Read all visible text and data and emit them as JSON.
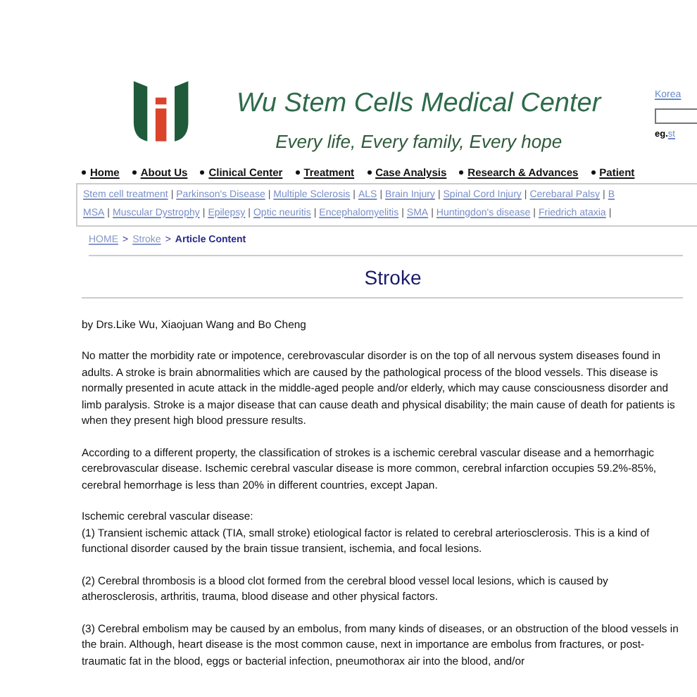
{
  "header": {
    "title": "Wu Stem Cells Medical Center",
    "tagline": "Every life, Every family, Every hope",
    "language_link": "Korea",
    "example_label": "eg.",
    "example_link": "st"
  },
  "nav": [
    "Home",
    "About Us",
    "Clinical Center",
    "Treatment",
    "Case Analysis",
    "Research & Advances",
    "Patient"
  ],
  "subnav_separator": "|",
  "breadcrumb_separator": ">",
  "subnav_rows": [
    [
      "Stem cell treatment",
      "Parkinson's Disease",
      "Multiple Sclerosis",
      "ALS",
      "Brain Injury",
      "Spinal Cord Injury",
      "Cerebaral Palsy",
      "B"
    ],
    [
      "MSA",
      "Muscular Dystrophy",
      "Epilepsy",
      "Optic neuritis",
      "Encephalomyelitis",
      "SMA",
      "Huntingdon's disease",
      "Friedrich ataxia"
    ]
  ],
  "breadcrumb": [
    {
      "label": "HOME",
      "kind": "link"
    },
    {
      "label": "Stroke",
      "kind": "link"
    },
    {
      "label": "Article Content",
      "kind": "current"
    }
  ],
  "article": {
    "title": "Stroke",
    "byline": "by Drs.Like Wu, Xiaojuan Wang and Bo Cheng",
    "paragraphs": [
      [
        "No matter the morbidity rate or impotence, cerebrovascular disorder is on the top of all nervous system diseases found in adults. A stroke is brain abnormalities which are caused by the pathological process of the blood vessels. This disease is normally presented in acute attack in the middle-aged people and/or elderly, which may cause consciousness disorder and limb paralysis. Stroke is a major disease that can cause death and physical disability; the main cause of death for patients is when they present high blood pressure results."
      ],
      [
        "According to a different property, the classification of strokes is a ischemic cerebral vascular disease and a hemorrhagic cerebrovascular disease. Ischemic cerebral vascular disease is more common, cerebral infarction occupies 59.2%-85%, cerebral hemorrhage is less than 20% in different countries, except Japan."
      ],
      [
        "Ischemic cerebral vascular disease:",
        "(1) Transient ischemic attack (TIA, small stroke) etiological factor is related to cerebral arteriosclerosis. This is a kind of functional disorder caused by the brain tissue transient, ischemia, and focal lesions."
      ],
      [
        "(2) Cerebral thrombosis is a blood clot formed from the cerebral blood vessel local lesions, which is caused by atherosclerosis, arthritis, trauma, blood disease and other physical factors."
      ],
      [
        "(3) Cerebral embolism may be caused by an embolus, from many kinds of diseases, or an obstruction of the blood vessels in the brain.  Although, heart disease is the most common cause, next in importance are embolus from fractures, or post-traumatic fat in the blood, eggs or bacterial infection, pneumothorax air into the blood, and/or"
      ]
    ]
  }
}
